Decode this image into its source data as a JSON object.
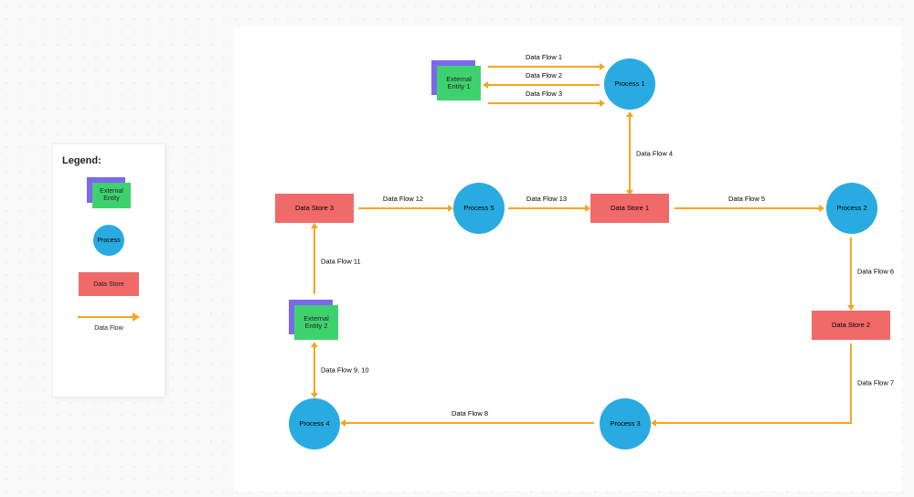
{
  "legend": {
    "title": "Legend:",
    "external_entity": "External Entity",
    "process": "Process",
    "datastore": "Data Store",
    "dataflow": "Data Flow"
  },
  "nodes": {
    "ext1": "External Entity 1",
    "ext2": "External Entity 2",
    "p1": "Process 1",
    "p2": "Process 2",
    "p3": "Process 3",
    "p4": "Process 4",
    "p5": "Process 5",
    "ds1": "Data Store 1",
    "ds2": "Data Store 2",
    "ds3": "Data Store 3"
  },
  "flows": {
    "f1": "Data Flow 1",
    "f2": "Data Flow 2",
    "f3": "Data Flow 3",
    "f4": "Data Flow 4",
    "f5": "Data Flow 5",
    "f6": "Data Flow 6",
    "f7": "Data Flow 7",
    "f8": "Data Flow 8",
    "f9_10": "Data Flow 9, 10",
    "f11": "Data Flow 11",
    "f12": "Data Flow 12",
    "f13": "Data Flow 13"
  },
  "colors": {
    "process": "#29abe2",
    "datastore": "#f16a6a",
    "entity_front": "#3ed26f",
    "entity_back": "#7b68ee",
    "flow": "#f5a623"
  }
}
